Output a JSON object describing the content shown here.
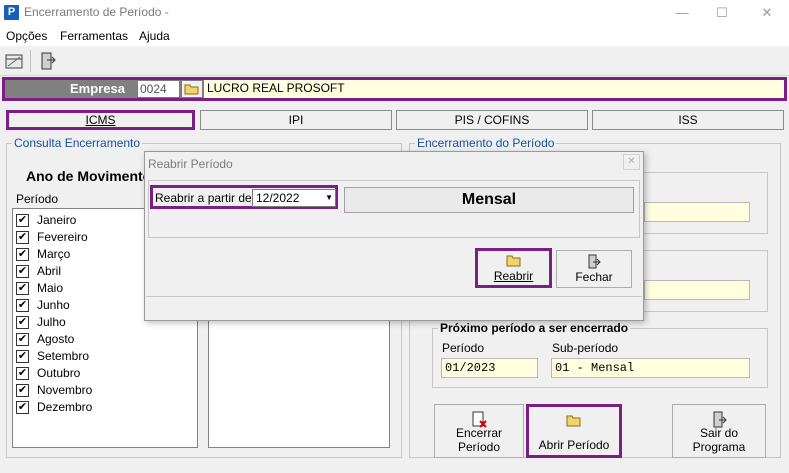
{
  "window": {
    "title": "Encerramento de Período -",
    "app_icon": "P"
  },
  "menu": [
    "Opções",
    "Ferramentas",
    "Ajuda"
  ],
  "empresa": {
    "label": "Empresa",
    "code": "0024",
    "name": "LUCRO REAL PROSOFT"
  },
  "tabs": [
    "ICMS",
    "IPI",
    "PIS / COFINS",
    "ISS"
  ],
  "consulta": {
    "title": "Consulta Encerramento",
    "ano_label": "Ano de Movimento",
    "periodo_header": "Período",
    "months": [
      "Janeiro",
      "Fevereiro",
      "Março",
      "Abril",
      "Maio",
      "Junho",
      "Julho",
      "Agosto",
      "Setembro",
      "Outubro",
      "Novembro",
      "Dezembro"
    ]
  },
  "encerramento": {
    "title": "Encerramento do Período",
    "proximo_title": "Próximo período a ser encerrado",
    "periodo_label": "Período",
    "periodo_value": "01/2023",
    "subperiodo_label": "Sub-período",
    "subperiodo_value": "01 - Mensal"
  },
  "buttons": {
    "encerrar": "Encerrar Período",
    "abrir": "Abrir Período",
    "sair": "Sair do Programa"
  },
  "dialog": {
    "title": "Reabrir Período",
    "reabrir_label": "Reabrir a partir de",
    "reabrir_value": "12/2022",
    "mensal": "Mensal",
    "reabrir_button": "Reabrir",
    "fechar_button": "Fechar"
  },
  "colors": {
    "highlight": "#7b1f86",
    "field_bg": "#ffffe0",
    "group_title": "#1a4fa0"
  }
}
